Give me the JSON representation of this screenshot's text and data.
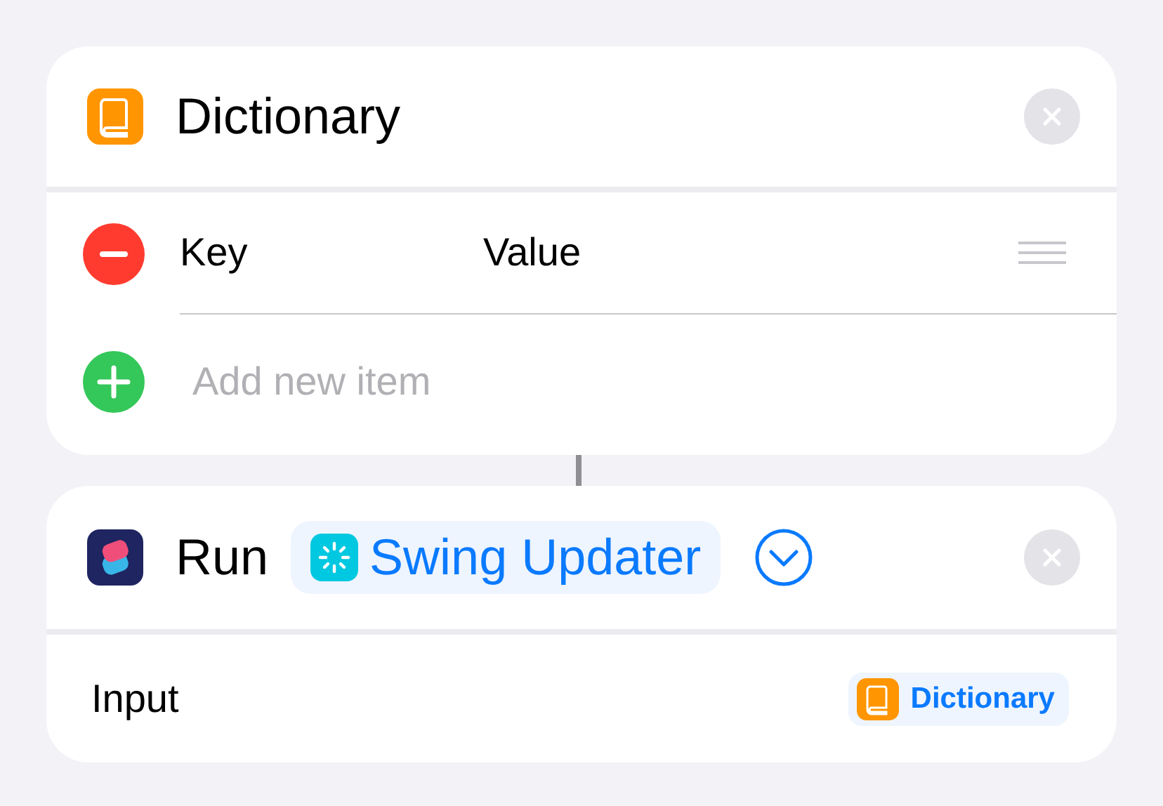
{
  "dictionary_action": {
    "title": "Dictionary",
    "items": [
      {
        "key": "Key",
        "value": "Value"
      }
    ],
    "add_label": "Add new item"
  },
  "run_action": {
    "verb": "Run",
    "shortcut": "Swing Updater",
    "input_label": "Input",
    "input_value": "Dictionary"
  }
}
